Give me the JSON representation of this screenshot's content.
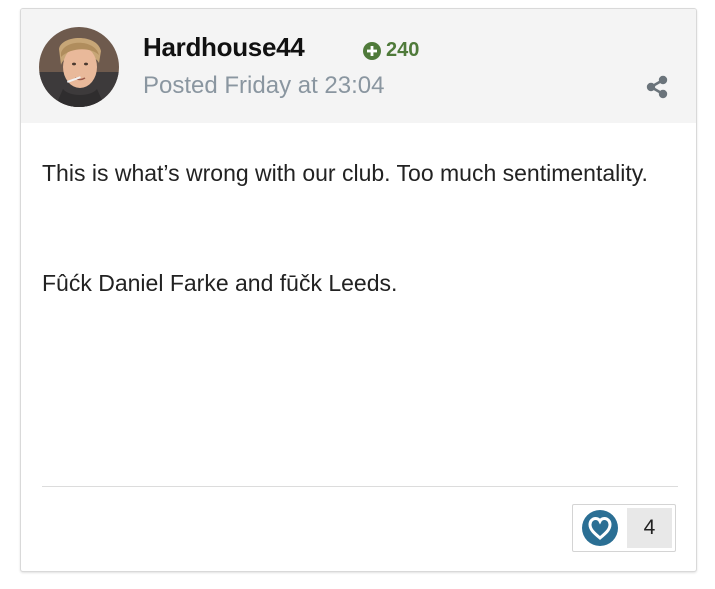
{
  "post": {
    "author": "Hardhouse44",
    "reputation": "240",
    "posted": "Posted Friday at 23:04",
    "body": {
      "line1": "This is what’s wrong with our club. Too much sentimentality.",
      "line2": "Fûćk Daniel Farke and fūčk Leeds."
    },
    "reaction_count": "4"
  },
  "icons": {
    "reputation": "plus-circle-icon",
    "share": "share-icon",
    "reaction": "heart-icon"
  },
  "colors": {
    "reputation": "#4f7a3a",
    "header_bg": "#f4f4f4",
    "date": "#8a96a0",
    "heart_badge": "#2b6f94"
  }
}
